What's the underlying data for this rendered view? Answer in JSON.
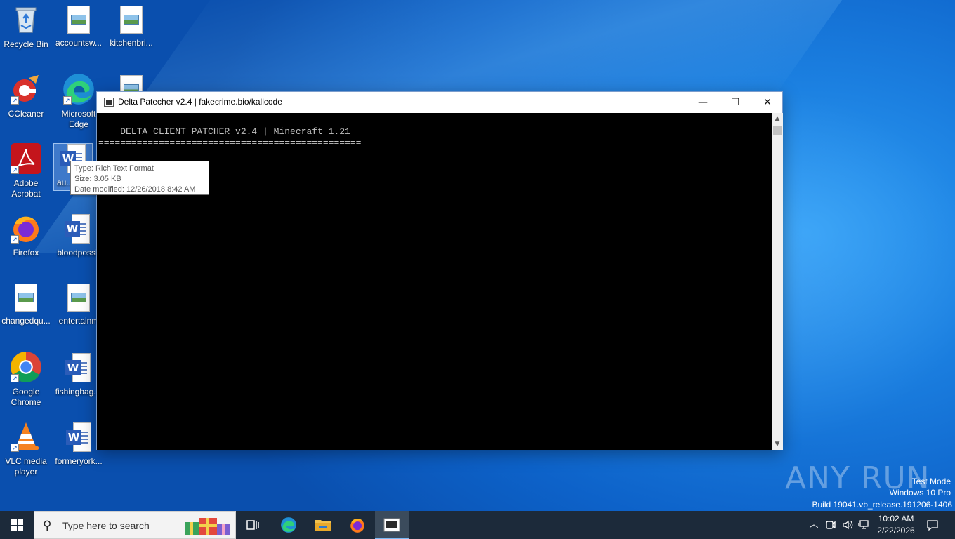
{
  "desktop": {
    "icons": [
      {
        "label": "Recycle Bin"
      },
      {
        "label": "accountsw..."
      },
      {
        "label": "kitchenbri..."
      },
      {
        "label": "CCleaner"
      },
      {
        "label": "Microsoft Edge"
      },
      {
        "label": "Adobe Acrobat"
      },
      {
        "label": "au..."
      },
      {
        "label": "Firefox"
      },
      {
        "label": "bloodpossi"
      },
      {
        "label": "changedqu..."
      },
      {
        "label": "entertainm"
      },
      {
        "label": "Google Chrome"
      },
      {
        "label": "fishingbag..."
      },
      {
        "label": "VLC media player"
      },
      {
        "label": "formeryork..."
      }
    ]
  },
  "tooltip": {
    "type_line": "Type: Rich Text Format",
    "size_line": "Size: 3.05 KB",
    "date_line": "Date modified: 12/26/2018 8:42 AM"
  },
  "console_window": {
    "title": "Delta Patecher v2.4 | fakecrime.bio/kallcode",
    "minimize_glyph": "—",
    "maximize_glyph": "☐",
    "close_glyph": "✕",
    "lines": [
      "================================================",
      "    DELTA CLIENT PATCHER v2.4 | Minecraft 1.21",
      "================================================"
    ]
  },
  "watermark": {
    "logo": "ANY RUN",
    "mode": "Test Mode",
    "os": "Windows 10 Pro",
    "build": "Build 19041.vb_release.191206-1406"
  },
  "taskbar": {
    "search_placeholder": "Type here to search",
    "clock_time": "10:02 AM",
    "clock_date": "2/22/2026"
  },
  "colors": {
    "taskbar_bg": "#1c2a3a",
    "console_bg": "#000000",
    "console_fg": "#c0c0c0",
    "accent": "#0d62c9"
  }
}
